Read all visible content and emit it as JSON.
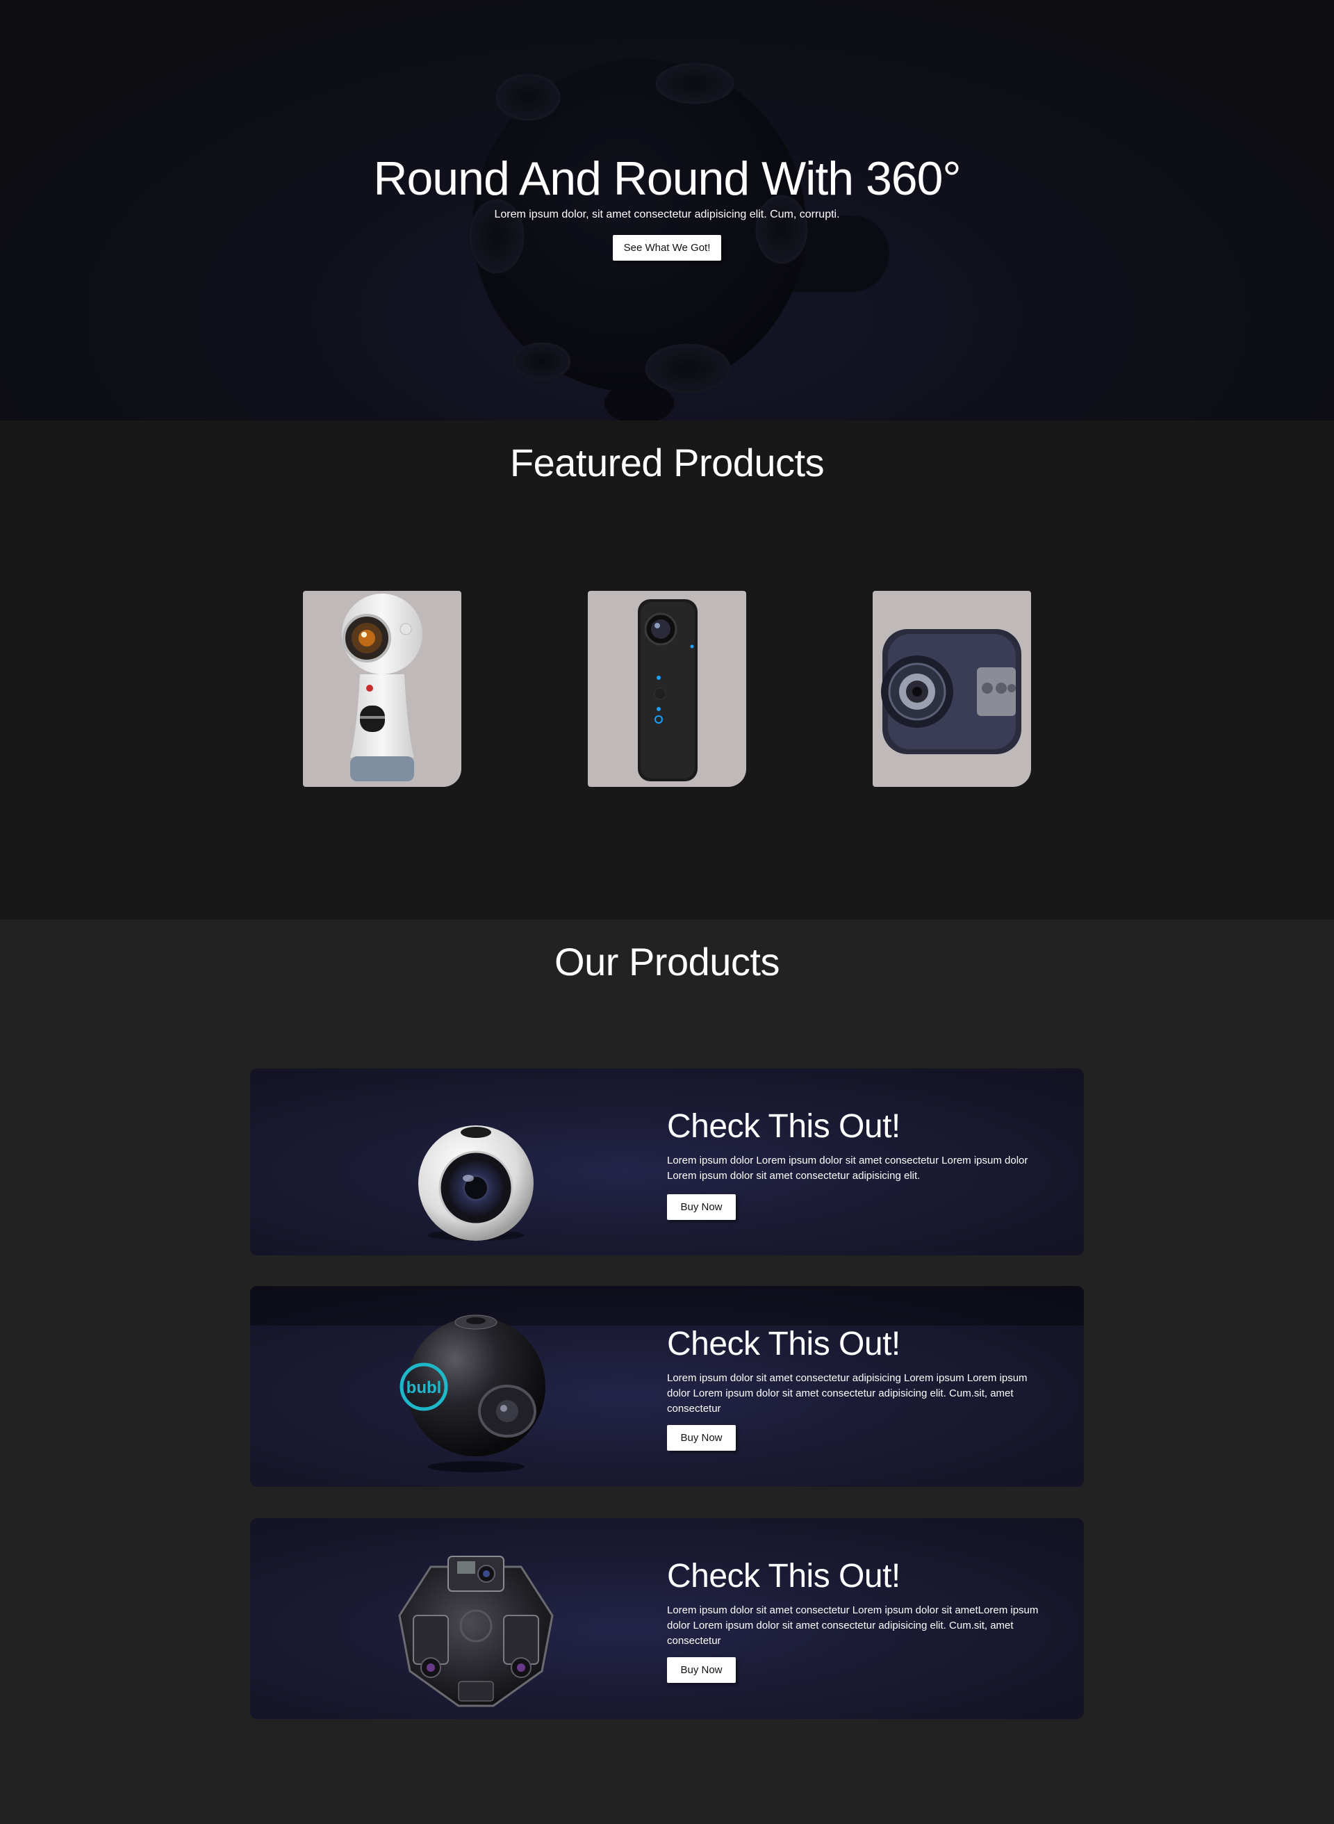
{
  "hero": {
    "title": "Round And Round With 360°",
    "subtitle": "Lorem ipsum dolor, sit amet consectetur adipisicing elit. Cum, corrupti.",
    "button_label": "See What We Got!"
  },
  "featured": {
    "title": "Featured Products",
    "items": [
      {
        "icon": "samsung-gear-360-camera-icon"
      },
      {
        "icon": "ricoh-theta-camera-icon"
      },
      {
        "icon": "cube-action-camera-icon"
      }
    ]
  },
  "products": {
    "title": "Our Products",
    "items": [
      {
        "title": "Check This Out!",
        "description": "Lorem ipsum dolor Lorem ipsum dolor sit amet consectetur Lorem ipsum dolor Lorem ipsum dolor sit amet consectetur adipisicing elit.",
        "button_label": "Buy Now",
        "icon": "gear-360-sphere-camera-icon"
      },
      {
        "title": "Check This Out!",
        "description": "Lorem ipsum dolor sit amet consectetur adipisicing Lorem ipsum Lorem ipsum dolor Lorem ipsum dolor sit amet consectetur adipisicing elit. Cum.sit, amet consectetur",
        "button_label": "Buy Now",
        "icon": "bubl-sphere-camera-icon",
        "logo_text": "bubl"
      },
      {
        "title": "Check This Out!",
        "description": "Lorem ipsum dolor sit amet consectetur Lorem ipsum dolor sit ametLorem ipsum dolor Lorem ipsum dolor sit amet consectetur adipisicing elit. Cum.sit, amet consectetur",
        "button_label": "Buy Now",
        "icon": "gopro-360-rig-icon"
      }
    ]
  },
  "colors": {
    "hero_bg": "#141420",
    "featured_bg": "#181818",
    "products_bg": "#222222",
    "card_bg": "#1a1a33",
    "product_tile_bg": "#c0b9b9",
    "button_bg": "#ffffff",
    "accent_cyan": "#1fb8c8"
  }
}
